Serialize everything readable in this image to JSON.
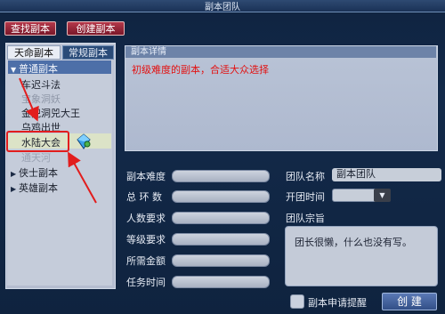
{
  "window": {
    "title": "副本团队"
  },
  "toolbar": {
    "find_label": "查找副本",
    "create_label": "创建副本"
  },
  "tabs": [
    {
      "label": "天命副本"
    },
    {
      "label": "常规副本"
    }
  ],
  "tree": {
    "groups": [
      {
        "label": "普通副本",
        "expanded": true
      },
      {
        "label": "侠士副本",
        "expanded": false
      },
      {
        "label": "英雄副本",
        "expanded": false
      }
    ],
    "items": [
      {
        "label": "车迟斗法"
      },
      {
        "label": "宝象洞妖"
      },
      {
        "label": "金兜洞兕大王"
      },
      {
        "label": "乌鸡出世"
      },
      {
        "label": "水陆大会"
      },
      {
        "label": "通天河"
      }
    ]
  },
  "detail": {
    "header": "副本详情",
    "text": "初级难度的副本，合适大众选择"
  },
  "form": {
    "difficulty_label": "副本难度",
    "rings_label": "总 环 数",
    "people_label": "人数要求",
    "level_label": "等级要求",
    "gold_label": "所需金额",
    "time_label": "任务时间",
    "team_name_label": "团队名称",
    "team_name_value": "副本团队",
    "open_time_label": "开团时间",
    "motto_label": "团队宗旨",
    "motto_value": "团长很懒，什么也没有写。",
    "apply_checkbox_label": "副本申请提醒",
    "create_button": "创 建"
  },
  "colors": {
    "background": "#132a4a",
    "highlight_red": "#e21d1d",
    "detail_text": "#e31010",
    "selection": "#4d6fa8"
  }
}
